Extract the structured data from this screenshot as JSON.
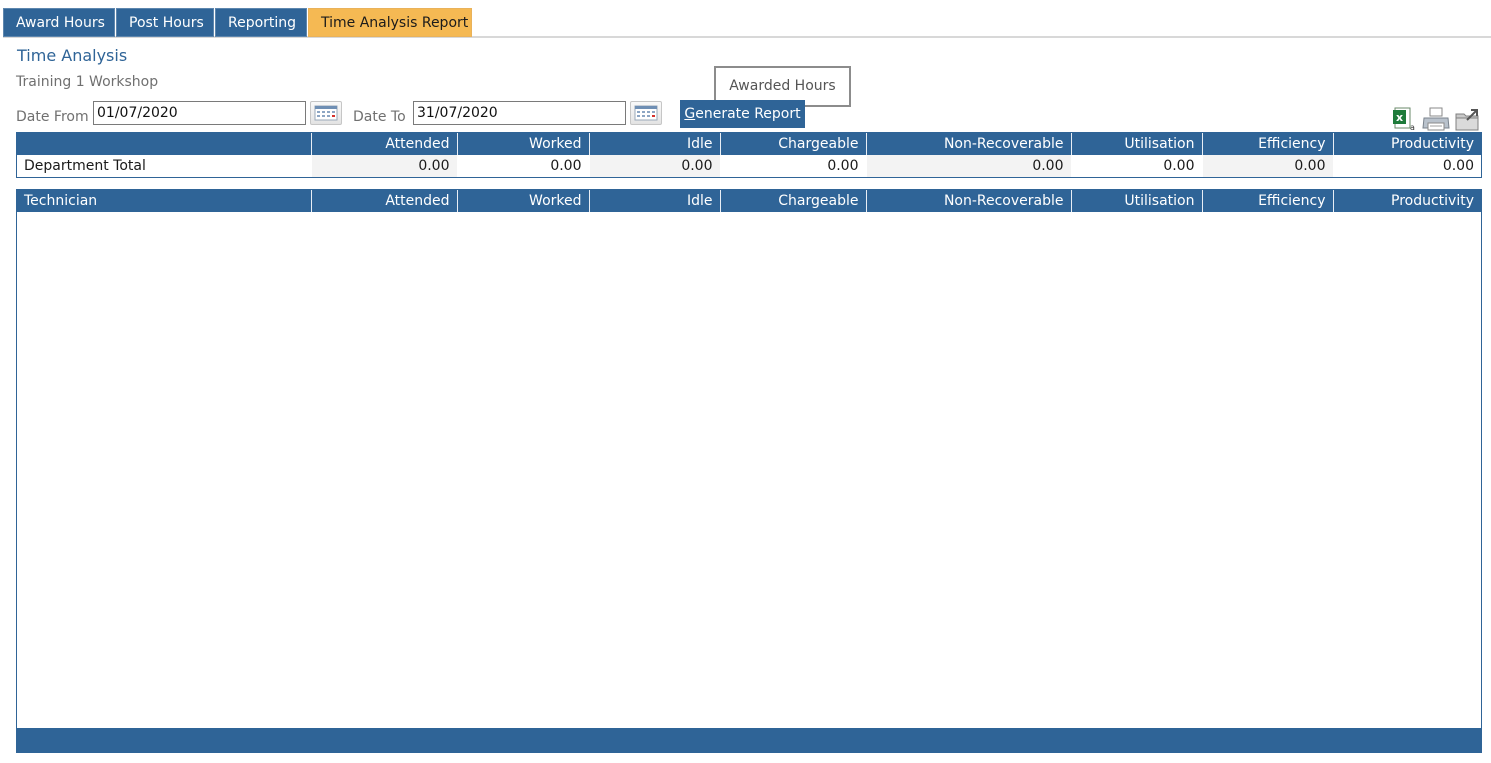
{
  "tabs": [
    {
      "label": "Award Hours",
      "active": false
    },
    {
      "label": "Post Hours",
      "active": false
    },
    {
      "label": "Reporting",
      "active": false
    },
    {
      "label": "Time Analysis Report",
      "active": true
    }
  ],
  "page": {
    "title": "Time Analysis",
    "subtitle": "Training 1 Workshop"
  },
  "tooltip": "Awarded Hours",
  "filters": {
    "date_from_label": "Date From",
    "date_from_value": "01/07/2020",
    "date_to_label": "Date To",
    "date_to_value": "31/07/2020",
    "calendar_icon": "calendar-icon",
    "generate_label": "Generate Report",
    "generate_shortcut": "G"
  },
  "toolbar": {
    "icons": [
      "excel-export-icon",
      "print-icon",
      "export-icon"
    ]
  },
  "department_table": {
    "columns": [
      "",
      "Attended",
      "Worked",
      "Idle",
      "Chargeable",
      "Non-Recoverable",
      "Utilisation",
      "Efficiency",
      "Productivity"
    ],
    "rows": [
      [
        "Department Total",
        "0.00",
        "0.00",
        "0.00",
        "0.00",
        "0.00",
        "0.00",
        "0.00",
        "0.00"
      ]
    ]
  },
  "technician_table": {
    "columns": [
      "Technician",
      "Attended",
      "Worked",
      "Idle",
      "Chargeable",
      "Non-Recoverable",
      "Utilisation",
      "Efficiency",
      "Productivity"
    ],
    "rows": []
  },
  "colors": {
    "header_blue": "#2f6497",
    "active_tab": "#f5b953",
    "excel_green": "#1e7b3a"
  }
}
